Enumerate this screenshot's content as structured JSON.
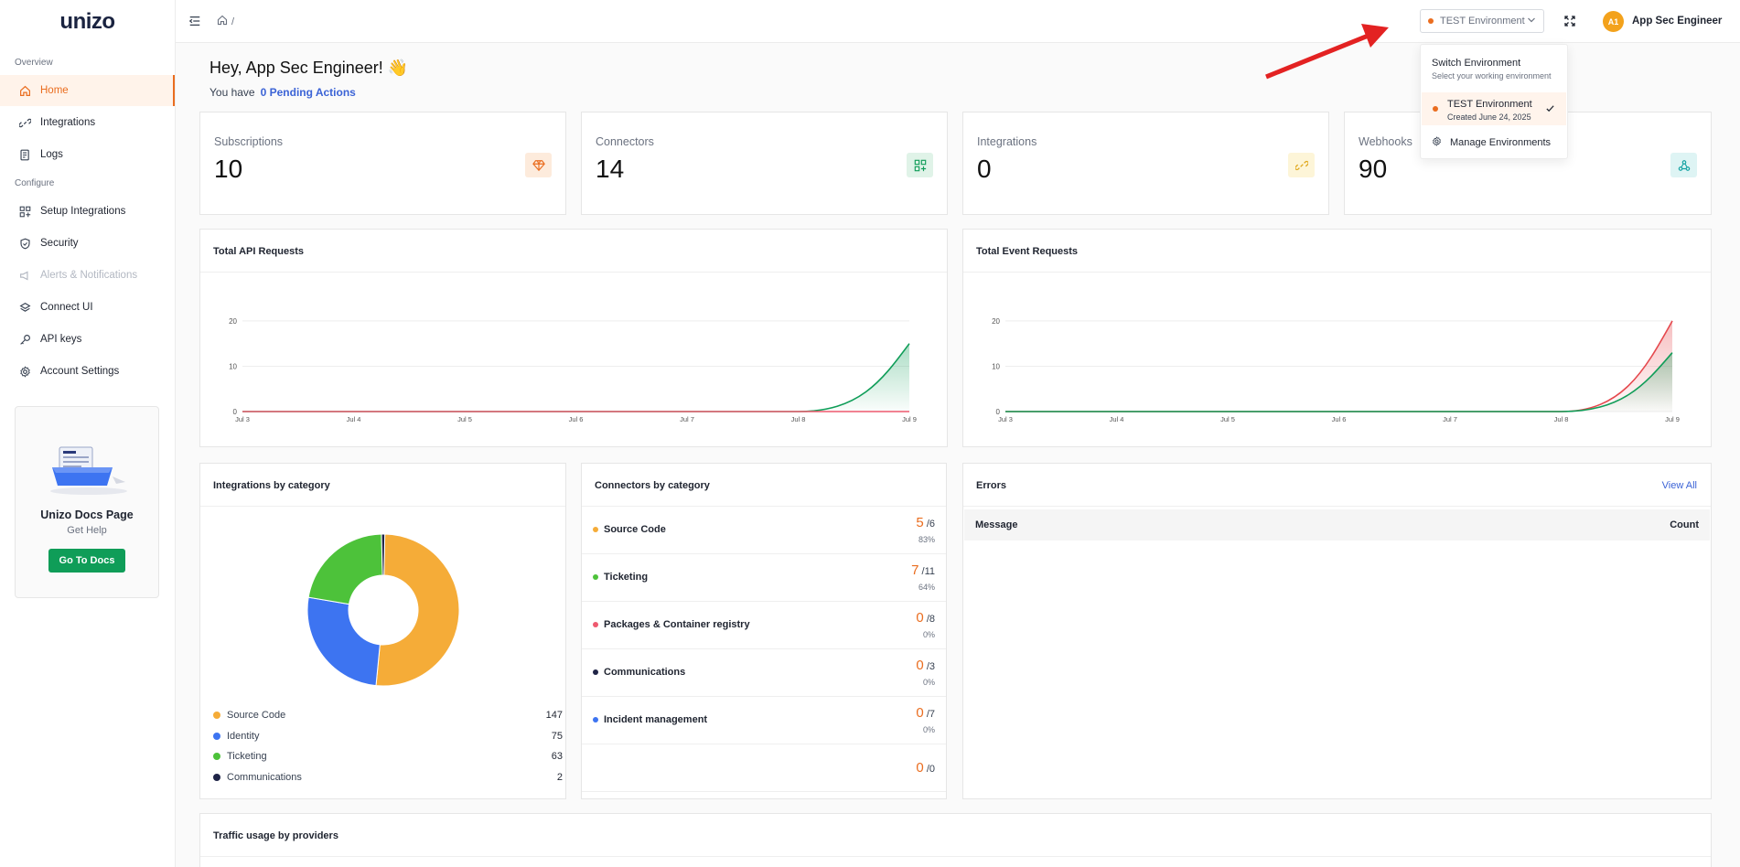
{
  "app": {
    "logo": "unizo"
  },
  "sidebar": {
    "section_overview": "Overview",
    "section_configure": "Configure",
    "items": [
      {
        "label": "Home"
      },
      {
        "label": "Integrations"
      },
      {
        "label": "Logs"
      },
      {
        "label": "Setup Integrations"
      },
      {
        "label": "Security"
      },
      {
        "label": "Alerts & Notifications"
      },
      {
        "label": "Connect UI"
      },
      {
        "label": "API keys"
      },
      {
        "label": "Account Settings"
      }
    ],
    "docs_card": {
      "title": "Unizo Docs Page",
      "subtitle": "Get Help",
      "button": "Go To Docs"
    }
  },
  "topbar": {
    "breadcrumb_sep": "/",
    "env_label": "TEST Environment",
    "avatar_initials": "A1",
    "user_name": "App Sec Engineer"
  },
  "env_dropdown": {
    "title": "Switch Environment",
    "subtitle": "Select your working environment",
    "env_name": "TEST Environment",
    "env_created": "Created June 24, 2025",
    "manage": "Manage Environments"
  },
  "greeting": {
    "title": "Hey, App Sec Engineer! 👋",
    "prefix": "You have",
    "pending": "0 Pending Actions"
  },
  "stats": [
    {
      "label": "Subscriptions",
      "value": "10"
    },
    {
      "label": "Connectors",
      "value": "14"
    },
    {
      "label": "Integrations",
      "value": "0"
    },
    {
      "label": "Webhooks",
      "value": "90"
    }
  ],
  "colors": {
    "accent": "#ea6d1f",
    "link": "#3b63d6",
    "green": "#0f9d58",
    "source_code": "#f5ac38",
    "identity": "#3d74f1",
    "ticketing": "#4dc23a",
    "communications": "#1f2447",
    "packages": "#ee5a6f"
  },
  "chart_data": [
    {
      "type": "area",
      "title": "Total API Requests",
      "categories": [
        "Jul 3",
        "Jul 4",
        "Jul 5",
        "Jul 6",
        "Jul 7",
        "Jul 8",
        "Jul 9"
      ],
      "yticks": [
        0,
        10,
        20
      ],
      "ylim": [
        0,
        22
      ],
      "series": [
        {
          "values": [
            0,
            0,
            0,
            0,
            0,
            0,
            15
          ],
          "color": "#0f9d58"
        },
        {
          "values": [
            0,
            0,
            0,
            0,
            0,
            0,
            0
          ],
          "color": "#ee5a6f"
        }
      ]
    },
    {
      "type": "area",
      "title": "Total Event Requests",
      "categories": [
        "Jul 3",
        "Jul 4",
        "Jul 5",
        "Jul 6",
        "Jul 7",
        "Jul 8",
        "Jul 9"
      ],
      "yticks": [
        0,
        10,
        20
      ],
      "ylim": [
        0,
        22
      ],
      "series": [
        {
          "values": [
            0,
            0,
            0,
            0,
            0,
            0,
            20
          ],
          "color": "#e5484d"
        },
        {
          "values": [
            0,
            0,
            0,
            0,
            0,
            0,
            13
          ],
          "color": "#0f9d58"
        }
      ]
    },
    {
      "type": "pie",
      "title": "Integrations by category",
      "categories": [
        "Source Code",
        "Identity",
        "Ticketing",
        "Communications"
      ],
      "values": [
        147,
        75,
        63,
        2
      ],
      "colors": [
        "#f5ac38",
        "#3d74f1",
        "#4dc23a",
        "#1f2447"
      ]
    }
  ],
  "connectors": {
    "title": "Connectors by category",
    "rows": [
      {
        "name": "Source Code",
        "count": "5",
        "total": "/6",
        "pct": "83%",
        "color": "#f5ac38"
      },
      {
        "name": "Ticketing",
        "count": "7",
        "total": "/11",
        "pct": "64%",
        "color": "#4dc23a"
      },
      {
        "name": "Packages & Container registry",
        "count": "0",
        "total": "/8",
        "pct": "0%",
        "color": "#ee5a6f"
      },
      {
        "name": "Communications",
        "count": "0",
        "total": "/3",
        "pct": "0%",
        "color": "#1f2447"
      },
      {
        "name": "Incident management",
        "count": "0",
        "total": "/7",
        "pct": "0%",
        "color": "#3d74f1"
      },
      {
        "name": "",
        "count": "0",
        "total": "/0",
        "pct": "",
        "color": ""
      }
    ]
  },
  "errors": {
    "title": "Errors",
    "view_all": "View All",
    "col_message": "Message",
    "col_count": "Count"
  },
  "traffic": {
    "title": "Traffic usage by providers"
  }
}
